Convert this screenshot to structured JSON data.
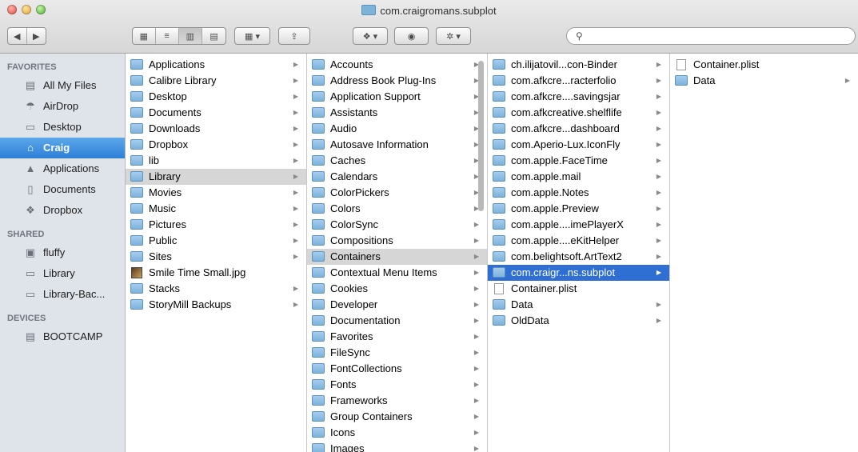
{
  "window": {
    "title": "com.craigromans.subplot"
  },
  "toolbar": {
    "back_icon": "chevron-left",
    "forward_icon": "chevron-right",
    "views": [
      "icon-view",
      "list-view",
      "column-view",
      "coverflow-view"
    ],
    "arrange": "arrange-icon",
    "share": "share-icon",
    "dropbox": "dropbox-icon",
    "quicklook": "eye-icon",
    "action": "gear-icon",
    "search_placeholder": ""
  },
  "sidebar": {
    "favorites_header": "FAVORITES",
    "favorites": [
      {
        "label": "All My Files",
        "icon": "files-icon"
      },
      {
        "label": "AirDrop",
        "icon": "airdrop-icon"
      },
      {
        "label": "Desktop",
        "icon": "desktop-icon"
      },
      {
        "label": "Craig",
        "icon": "home-icon"
      },
      {
        "label": "Applications",
        "icon": "applications-icon"
      },
      {
        "label": "Documents",
        "icon": "documents-icon"
      },
      {
        "label": "Dropbox",
        "icon": "dropbox-icon"
      }
    ],
    "shared_header": "SHARED",
    "shared": [
      {
        "label": "fluffy",
        "icon": "server-icon"
      },
      {
        "label": "Library",
        "icon": "display-icon"
      },
      {
        "label": "Library-Bac...",
        "icon": "display-icon"
      }
    ],
    "devices_header": "DEVICES",
    "devices": [
      {
        "label": "BOOTCAMP",
        "icon": "disk-icon"
      }
    ]
  },
  "columns": [
    {
      "items": [
        {
          "label": "Applications",
          "type": "folder",
          "arrow": true
        },
        {
          "label": "Calibre Library",
          "type": "folder",
          "arrow": true
        },
        {
          "label": "Desktop",
          "type": "folder",
          "arrow": true
        },
        {
          "label": "Documents",
          "type": "folder",
          "arrow": true
        },
        {
          "label": "Downloads",
          "type": "folder",
          "arrow": true
        },
        {
          "label": "Dropbox",
          "type": "folder",
          "arrow": true
        },
        {
          "label": "lib",
          "type": "folder",
          "arrow": true
        },
        {
          "label": "Library",
          "type": "folder",
          "arrow": true,
          "state": "grey"
        },
        {
          "label": "Movies",
          "type": "folder",
          "arrow": true
        },
        {
          "label": "Music",
          "type": "folder",
          "arrow": true
        },
        {
          "label": "Pictures",
          "type": "folder",
          "arrow": true
        },
        {
          "label": "Public",
          "type": "folder",
          "arrow": true
        },
        {
          "label": "Sites",
          "type": "folder",
          "arrow": true
        },
        {
          "label": "Smile Time Small.jpg",
          "type": "image",
          "arrow": false
        },
        {
          "label": "Stacks",
          "type": "folder",
          "arrow": true
        },
        {
          "label": "StoryMill Backups",
          "type": "folder",
          "arrow": true
        }
      ]
    },
    {
      "items": [
        {
          "label": "Accounts",
          "type": "folder",
          "arrow": true
        },
        {
          "label": "Address Book Plug-Ins",
          "type": "folder",
          "arrow": true
        },
        {
          "label": "Application Support",
          "type": "folder",
          "arrow": true
        },
        {
          "label": "Assistants",
          "type": "folder",
          "arrow": true
        },
        {
          "label": "Audio",
          "type": "folder",
          "arrow": true
        },
        {
          "label": "Autosave Information",
          "type": "folder",
          "arrow": true
        },
        {
          "label": "Caches",
          "type": "folder",
          "arrow": true
        },
        {
          "label": "Calendars",
          "type": "folder",
          "arrow": true
        },
        {
          "label": "ColorPickers",
          "type": "folder",
          "arrow": true
        },
        {
          "label": "Colors",
          "type": "folder",
          "arrow": true
        },
        {
          "label": "ColorSync",
          "type": "folder",
          "arrow": true
        },
        {
          "label": "Compositions",
          "type": "folder",
          "arrow": true
        },
        {
          "label": "Containers",
          "type": "folder",
          "arrow": true,
          "state": "grey"
        },
        {
          "label": "Contextual Menu Items",
          "type": "folder",
          "arrow": true
        },
        {
          "label": "Cookies",
          "type": "folder",
          "arrow": true
        },
        {
          "label": "Developer",
          "type": "folder",
          "arrow": true
        },
        {
          "label": "Documentation",
          "type": "folder",
          "arrow": true
        },
        {
          "label": "Favorites",
          "type": "folder",
          "arrow": true
        },
        {
          "label": "FileSync",
          "type": "folder",
          "arrow": true
        },
        {
          "label": "FontCollections",
          "type": "folder",
          "arrow": true
        },
        {
          "label": "Fonts",
          "type": "folder",
          "arrow": true
        },
        {
          "label": "Frameworks",
          "type": "folder",
          "arrow": true
        },
        {
          "label": "Group Containers",
          "type": "folder",
          "arrow": true
        },
        {
          "label": "Icons",
          "type": "folder",
          "arrow": true
        },
        {
          "label": "Images",
          "type": "folder",
          "arrow": true
        }
      ]
    },
    {
      "items": [
        {
          "label": "ch.ilijatovil...con-Binder",
          "type": "folder",
          "arrow": true
        },
        {
          "label": "com.afkcre...racterfolio",
          "type": "folder",
          "arrow": true
        },
        {
          "label": "com.afkcre....savingsjar",
          "type": "folder",
          "arrow": true
        },
        {
          "label": "com.afkcreative.shelflife",
          "type": "folder",
          "arrow": true
        },
        {
          "label": "com.afkcre...dashboard",
          "type": "folder",
          "arrow": true
        },
        {
          "label": "com.Aperio-Lux.IconFly",
          "type": "folder",
          "arrow": true
        },
        {
          "label": "com.apple.FaceTime",
          "type": "folder",
          "arrow": true
        },
        {
          "label": "com.apple.mail",
          "type": "folder",
          "arrow": true
        },
        {
          "label": "com.apple.Notes",
          "type": "folder",
          "arrow": true
        },
        {
          "label": "com.apple.Preview",
          "type": "folder",
          "arrow": true
        },
        {
          "label": "com.apple....imePlayerX",
          "type": "folder",
          "arrow": true
        },
        {
          "label": "com.apple....eKitHelper",
          "type": "folder",
          "arrow": true
        },
        {
          "label": "com.belightsoft.ArtText2",
          "type": "folder",
          "arrow": true
        },
        {
          "label": "com.craigr...ns.subplot",
          "type": "folder",
          "arrow": true,
          "state": "blue"
        },
        {
          "label": "Container.plist",
          "type": "doc",
          "arrow": false
        },
        {
          "label": "Data",
          "type": "folder",
          "arrow": true
        },
        {
          "label": "OldData",
          "type": "folder",
          "arrow": true
        }
      ]
    },
    {
      "items": [
        {
          "label": "Container.plist",
          "type": "doc",
          "arrow": false
        },
        {
          "label": "Data",
          "type": "folder",
          "arrow": true
        }
      ]
    }
  ]
}
